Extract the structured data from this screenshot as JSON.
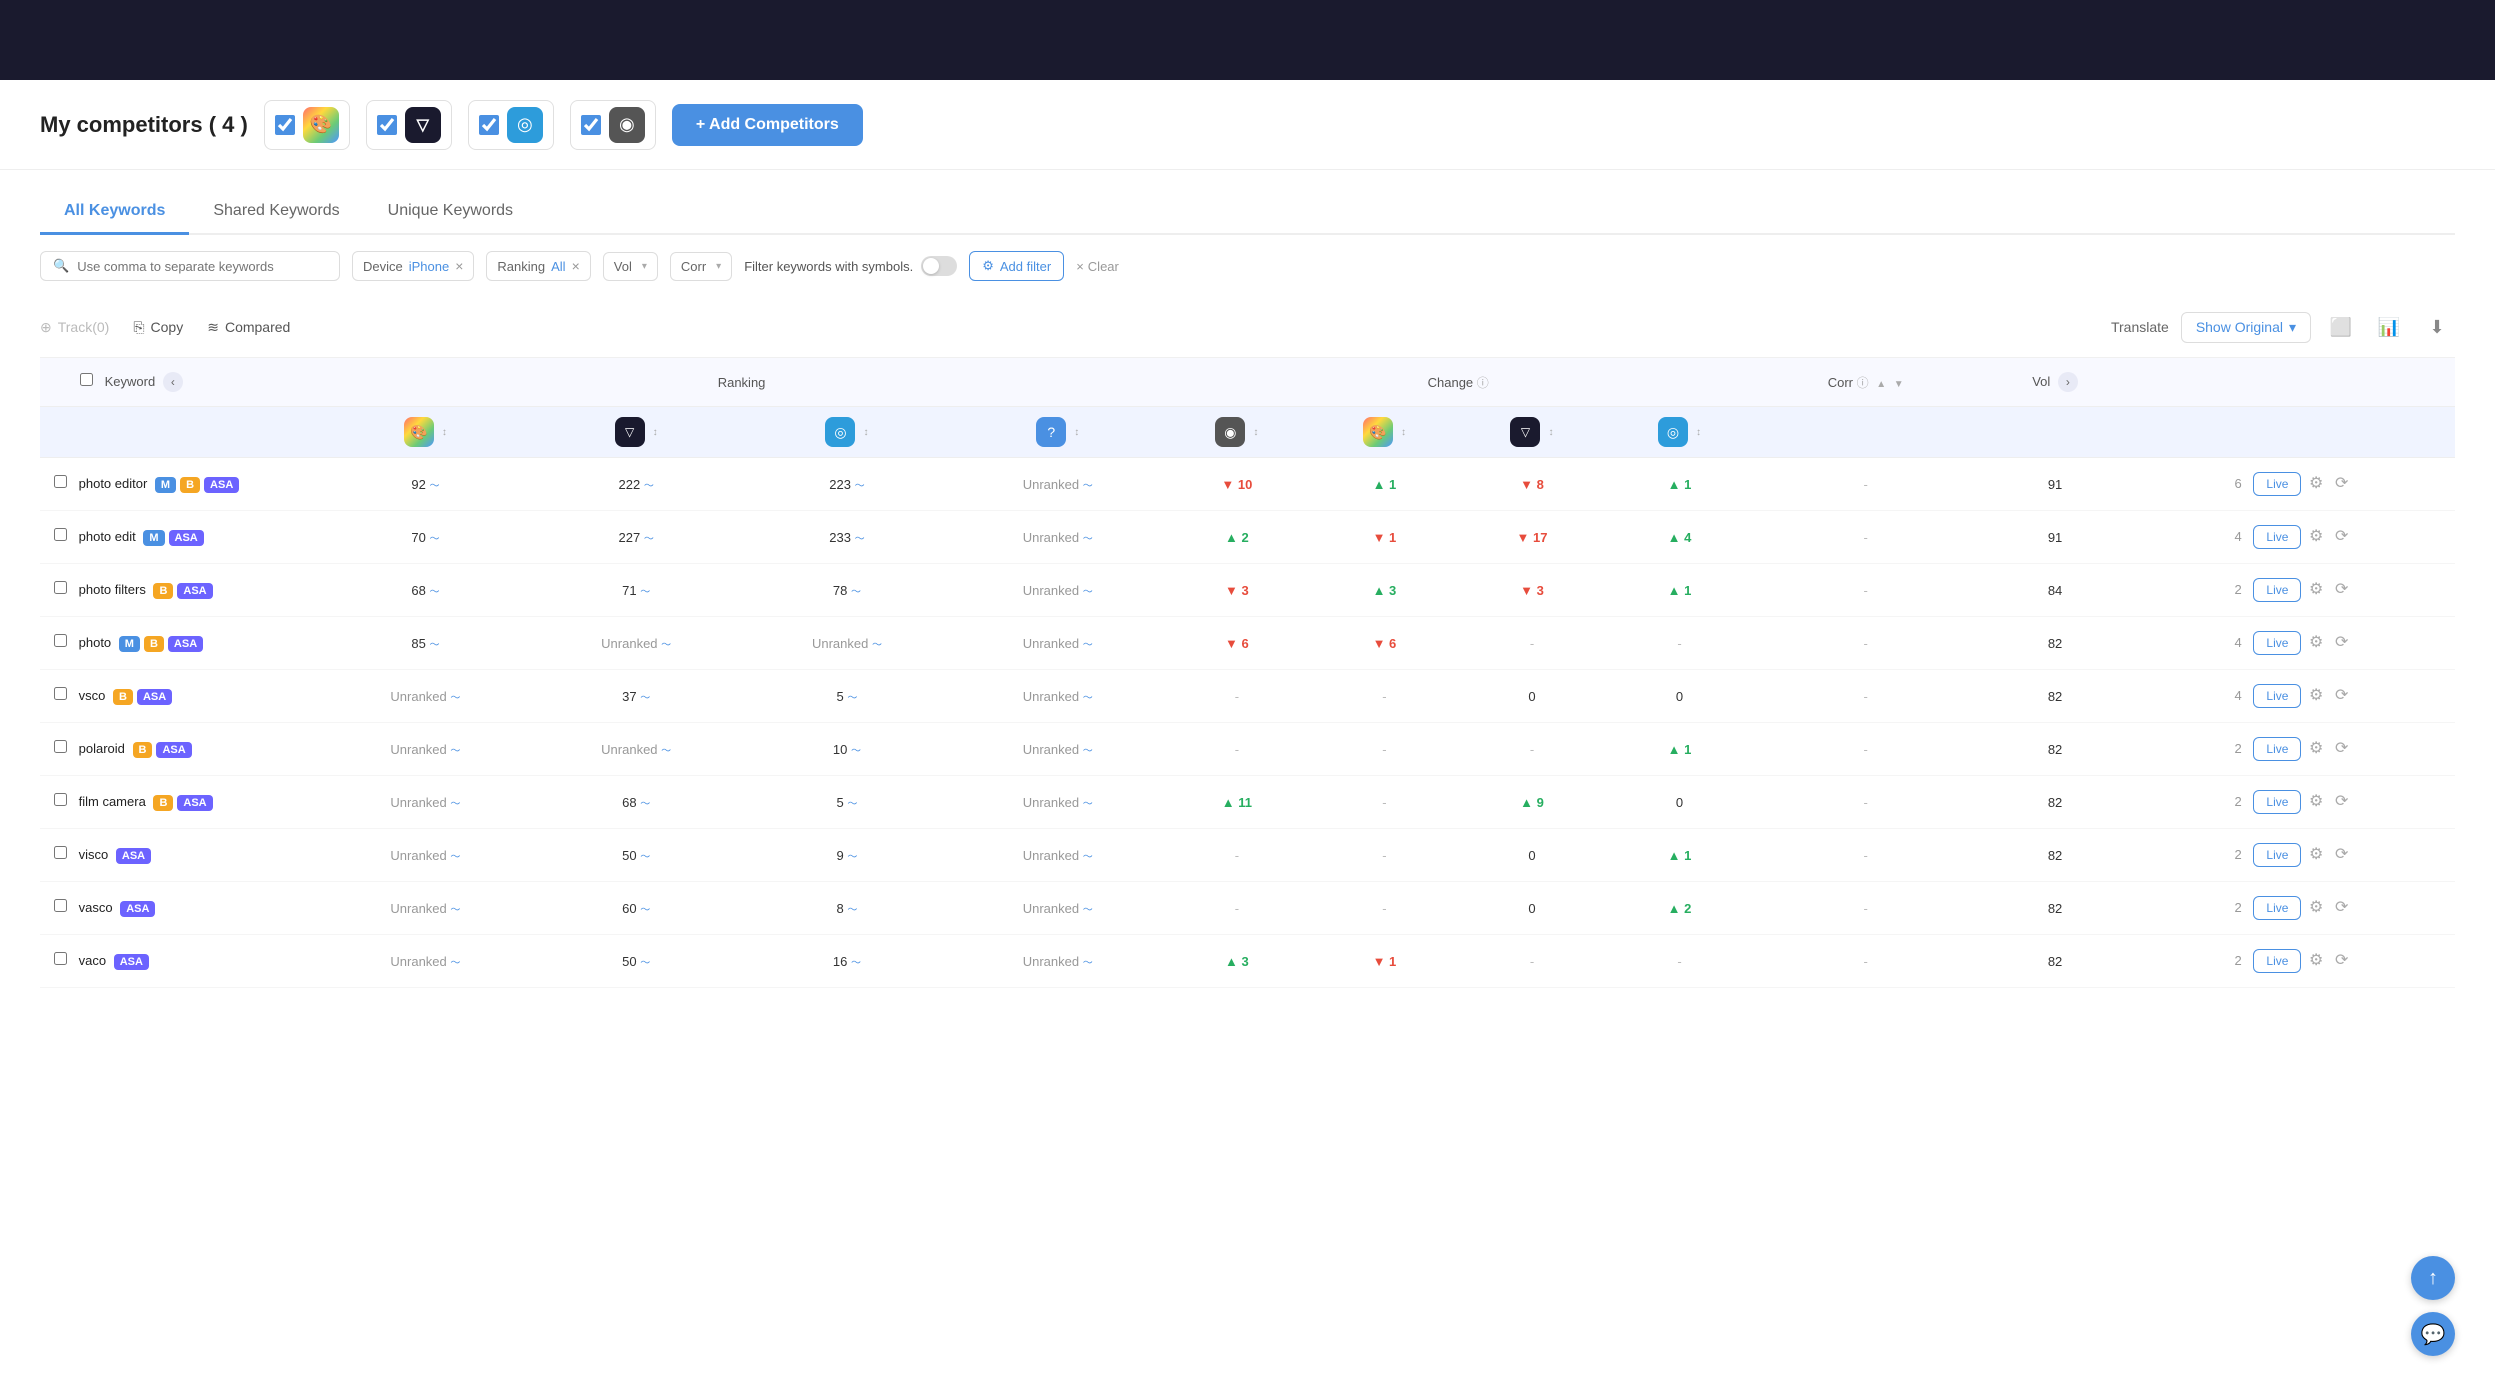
{
  "header": {
    "competitors_label": "My competitors ( 4 )",
    "add_competitors_label": "+ Add Competitors"
  },
  "competitors": [
    {
      "id": 1,
      "checked": true,
      "icon": "🎨",
      "bg": "linear-gradient(135deg,#ff6b6b,#ffd93d,#6bcb77,#4d96ff)"
    },
    {
      "id": 2,
      "checked": true,
      "icon": "▽",
      "bg": "#1a1a2e"
    },
    {
      "id": 3,
      "checked": true,
      "icon": "◎",
      "bg": "#2d9cdb"
    },
    {
      "id": 4,
      "checked": true,
      "icon": "◉",
      "bg": "#555"
    }
  ],
  "tabs": [
    {
      "id": "all",
      "label": "All Keywords",
      "active": true
    },
    {
      "id": "shared",
      "label": "Shared Keywords",
      "active": false
    },
    {
      "id": "unique",
      "label": "Unique Keywords",
      "active": false
    }
  ],
  "filters": {
    "keyword_placeholder": "Use comma to separate keywords",
    "device_label": "Device",
    "device_value": "iPhone",
    "ranking_label": "Ranking",
    "ranking_value": "All",
    "vol_label": "Vol",
    "corr_label": "Corr",
    "symbol_filter_label": "Filter keywords with symbols.",
    "add_filter_label": "Add filter",
    "clear_label": "Clear"
  },
  "toolbar": {
    "track_label": "Track(0)",
    "copy_label": "Copy",
    "compared_label": "Compared",
    "translate_label": "Translate",
    "show_original_label": "Show Original"
  },
  "table": {
    "columns": {
      "keyword": "Keyword",
      "ranking": "Ranking",
      "change": "Change",
      "corr": "Corr",
      "vol": "Vol"
    },
    "app_icons": [
      {
        "icon": "🎨",
        "bg": "linear-gradient(135deg,#ff6b6b,#ffd93d,#6bcb77,#4d96ff)"
      },
      {
        "icon": "▽",
        "bg": "#1a1a2e"
      },
      {
        "icon": "◎",
        "bg": "#2d9cdb"
      },
      {
        "icon": "?",
        "bg": "#4a90e2"
      },
      {
        "icon": "◉",
        "bg": "#555"
      },
      {
        "icon": "🎨",
        "bg": "linear-gradient(135deg,#ff6b6b,#ffd93d,#6bcb77,#4d96ff)"
      },
      {
        "icon": "▽",
        "bg": "#1a1a2e"
      },
      {
        "icon": "◎",
        "bg": "#2d9cdb"
      },
      {
        "icon": "?",
        "bg": "#4a90e2"
      }
    ],
    "rows": [
      {
        "keyword": "photo editor",
        "badges": [
          "M",
          "B",
          "ASA"
        ],
        "rankings": [
          92,
          222,
          223,
          "Unranked"
        ],
        "changes": [
          -10,
          1,
          -8,
          1
        ],
        "corr": "-",
        "vol": 91,
        "vol2": 6
      },
      {
        "keyword": "photo edit",
        "badges": [
          "M",
          "ASA"
        ],
        "rankings": [
          70,
          227,
          233,
          "Unranked"
        ],
        "changes": [
          2,
          -1,
          -17,
          4
        ],
        "corr": "-",
        "vol": 91,
        "vol2": 4
      },
      {
        "keyword": "photo filters",
        "badges": [
          "B",
          "ASA"
        ],
        "rankings": [
          68,
          71,
          78,
          "Unranked"
        ],
        "changes": [
          -3,
          3,
          -3,
          1
        ],
        "corr": "-",
        "vol": 84,
        "vol2": 2
      },
      {
        "keyword": "photo",
        "badges": [
          "M",
          "B",
          "ASA"
        ],
        "rankings": [
          85,
          "Unranked",
          "Unranked",
          "Unranked"
        ],
        "changes": [
          -6,
          -6,
          null,
          null
        ],
        "corr": "-",
        "vol": 82,
        "vol2": 4
      },
      {
        "keyword": "vsco",
        "badges": [
          "B",
          "ASA"
        ],
        "rankings": [
          "Unranked",
          37,
          5,
          "Unranked"
        ],
        "changes": [
          null,
          null,
          0,
          0
        ],
        "corr": "-",
        "vol": 82,
        "vol2": 4
      },
      {
        "keyword": "polaroid",
        "badges": [
          "B",
          "ASA"
        ],
        "rankings": [
          "Unranked",
          "Unranked",
          10,
          "Unranked"
        ],
        "changes": [
          null,
          null,
          null,
          1
        ],
        "corr": "-",
        "vol": 82,
        "vol2": 2
      },
      {
        "keyword": "film camera",
        "badges": [
          "B",
          "ASA"
        ],
        "rankings": [
          "Unranked",
          68,
          5,
          "Unranked"
        ],
        "changes": [
          11,
          null,
          9,
          0
        ],
        "corr": "-",
        "vol": 82,
        "vol2": 2
      },
      {
        "keyword": "visco",
        "badges": [
          "ASA"
        ],
        "rankings": [
          "Unranked",
          50,
          9,
          "Unranked"
        ],
        "changes": [
          null,
          null,
          0,
          1
        ],
        "corr": "-",
        "vol": 82,
        "vol2": 2
      },
      {
        "keyword": "vasco",
        "badges": [
          "ASA"
        ],
        "rankings": [
          "Unranked",
          60,
          8,
          "Unranked"
        ],
        "changes": [
          null,
          null,
          0,
          2
        ],
        "corr": "-",
        "vol": 82,
        "vol2": 2
      },
      {
        "keyword": "vaco",
        "badges": [
          "ASA"
        ],
        "rankings": [
          "Unranked",
          50,
          16,
          "Unranked"
        ],
        "changes": [
          3,
          -1,
          null,
          null
        ],
        "corr": "-",
        "vol": 82,
        "vol2": 2
      }
    ]
  }
}
